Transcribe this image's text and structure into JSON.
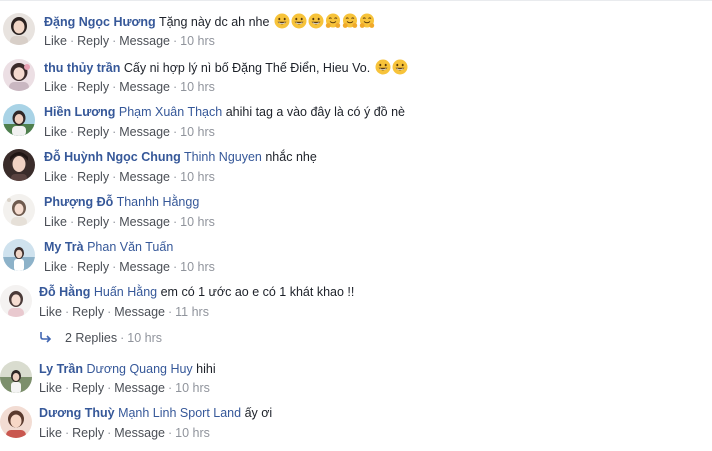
{
  "separator": "·",
  "comments": [
    {
      "author": "Đặng Ngọc Hương",
      "tags": [],
      "text": "Tặng này dc ah nhe",
      "emojis": [
        "grinning-face",
        "grinning-face",
        "grinning-face",
        "hugging-face",
        "hugging-face",
        "hugging-face"
      ],
      "actions": {
        "like": "Like",
        "reply": "Reply",
        "message": "Message"
      },
      "time": "10 hrs"
    },
    {
      "author": "thu thủy trần",
      "tags": [],
      "text": "Cấy ni hợp lý nì bố Đặng Thế Điển, Hieu Vo.",
      "emojis": [
        "grinning-face",
        "grinning-face"
      ],
      "actions": {
        "like": "Like",
        "reply": "Reply",
        "message": "Message"
      },
      "time": "10 hrs"
    },
    {
      "author": "Hiền Lương",
      "tags": [
        "Phạm Xuân Thạch"
      ],
      "text": "ahihi tag a vào đây là có ý đồ nè",
      "emojis": [],
      "actions": {
        "like": "Like",
        "reply": "Reply",
        "message": "Message"
      },
      "time": "10 hrs"
    },
    {
      "author": "Đỗ Huỳnh Ngọc Chung",
      "tags": [
        "Thinh Nguyen"
      ],
      "text": "nhắc nhẹ",
      "emojis": [],
      "actions": {
        "like": "Like",
        "reply": "Reply",
        "message": "Message"
      },
      "time": "10 hrs"
    },
    {
      "author": "Phượng Đỗ",
      "tags": [
        "Thanhh Hằngg"
      ],
      "text": "",
      "emojis": [],
      "actions": {
        "like": "Like",
        "reply": "Reply",
        "message": "Message"
      },
      "time": "10 hrs"
    },
    {
      "author": "My Trà",
      "tags": [
        "Phan Văn Tuấn"
      ],
      "text": "",
      "emojis": [],
      "actions": {
        "like": "Like",
        "reply": "Reply",
        "message": "Message"
      },
      "time": "10 hrs"
    },
    {
      "author": "Đỗ Hằng",
      "tags": [
        "Huấn Hằng"
      ],
      "text": "em có 1 ước ao e có 1 khát khao !!",
      "emojis": [],
      "actions": {
        "like": "Like",
        "reply": "Reply",
        "message": "Message"
      },
      "time": "11 hrs",
      "replies": {
        "count_label": "2 Replies",
        "time": "10 hrs"
      }
    },
    {
      "author": "Ly Trần",
      "tags": [
        "Dương Quang Huy"
      ],
      "text": "hihi",
      "emojis": [],
      "actions": {
        "like": "Like",
        "reply": "Reply",
        "message": "Message"
      },
      "time": "10 hrs"
    },
    {
      "author": "Dương Thuỳ",
      "tags": [
        "Mạnh Linh Sport Land"
      ],
      "text": "ấy ơi",
      "emojis": [],
      "actions": {
        "like": "Like",
        "reply": "Reply",
        "message": "Message"
      },
      "time": "10 hrs"
    }
  ]
}
